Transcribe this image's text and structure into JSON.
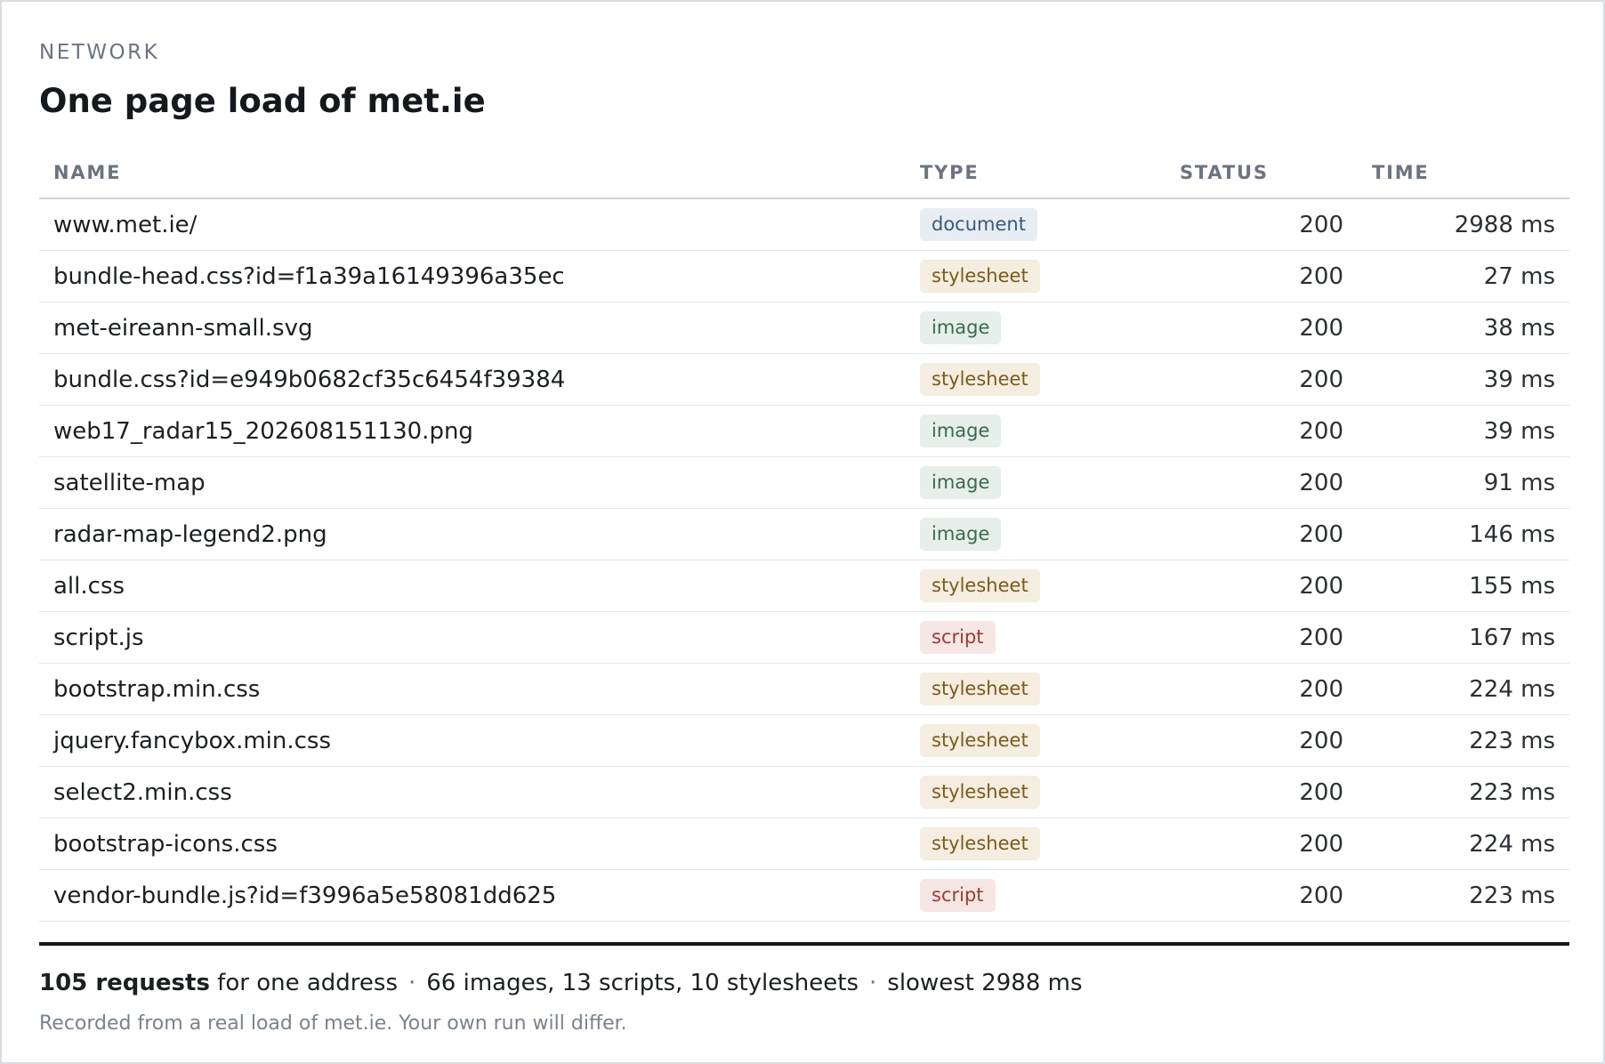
{
  "header": {
    "eyebrow": "NETWORK",
    "title": "One page load of met.ie"
  },
  "table": {
    "columns": [
      "NAME",
      "TYPE",
      "STATUS",
      "TIME"
    ],
    "rows": [
      {
        "name": "www.met.ie/",
        "type": "document",
        "status": "200",
        "time": "2988 ms"
      },
      {
        "name": "bundle-head.css?id=f1a39a16149396a35ec",
        "type": "stylesheet",
        "status": "200",
        "time": "27 ms"
      },
      {
        "name": "met-eireann-small.svg",
        "type": "image",
        "status": "200",
        "time": "38 ms"
      },
      {
        "name": "bundle.css?id=e949b0682cf35c6454f39384",
        "type": "stylesheet",
        "status": "200",
        "time": "39 ms"
      },
      {
        "name": "web17_radar15_202608151130.png",
        "type": "image",
        "status": "200",
        "time": "39 ms"
      },
      {
        "name": "satellite-map",
        "type": "image",
        "status": "200",
        "time": "91 ms"
      },
      {
        "name": "radar-map-legend2.png",
        "type": "image",
        "status": "200",
        "time": "146 ms"
      },
      {
        "name": "all.css",
        "type": "stylesheet",
        "status": "200",
        "time": "155 ms"
      },
      {
        "name": "script.js",
        "type": "script",
        "status": "200",
        "time": "167 ms"
      },
      {
        "name": "bootstrap.min.css",
        "type": "stylesheet",
        "status": "200",
        "time": "224 ms"
      },
      {
        "name": "jquery.fancybox.min.css",
        "type": "stylesheet",
        "status": "200",
        "time": "223 ms"
      },
      {
        "name": "select2.min.css",
        "type": "stylesheet",
        "status": "200",
        "time": "223 ms"
      },
      {
        "name": "bootstrap-icons.css",
        "type": "stylesheet",
        "status": "200",
        "time": "224 ms"
      },
      {
        "name": "vendor-bundle.js?id=f3996a5e58081dd625",
        "type": "script",
        "status": "200",
        "time": "223 ms"
      }
    ]
  },
  "summary": {
    "requests_bold": "105 requests",
    "requests_rest": " for one address",
    "separator": "·",
    "breakdown": "66 images, 13 scripts, 10 stylesheets",
    "slowest": "slowest 2988 ms"
  },
  "note": "Recorded from a real load of met.ie. Your own run will differ."
}
